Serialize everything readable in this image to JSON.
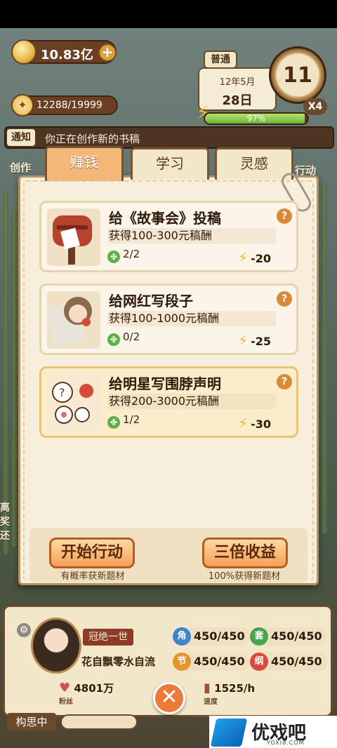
{
  "resources": {
    "coins": "10.83亿",
    "inspiration": "12288/19999",
    "plus_label": "+"
  },
  "calendar": {
    "mode": "普通",
    "month": "12年5月",
    "day": "28日",
    "hour": "11",
    "energy_percent_label": "97%",
    "energy_fraction": 0.97,
    "multiplier": "X4"
  },
  "notice": {
    "tag": "通知",
    "text": "你正在创作新的书稿"
  },
  "side": {
    "left_label": "创作",
    "right_label": "行动",
    "left_low": "离\n奖\n还"
  },
  "tabs": [
    {
      "label": "赚钱",
      "active": true
    },
    {
      "label": "学习",
      "active": false
    },
    {
      "label": "灵感",
      "active": false
    }
  ],
  "tasks": [
    {
      "title": "给《故事会》投稿",
      "reward": "获得100-300元稿酬",
      "count": "2/2",
      "cost": "-20",
      "highlight": false,
      "help": "?"
    },
    {
      "title": "给网红写段子",
      "reward": "获得100-1000元稿酬",
      "count": "0/2",
      "cost": "-25",
      "highlight": false,
      "help": "?"
    },
    {
      "title": "给明星写围脖声明",
      "reward": "获得200-3000元稿酬",
      "count": "1/2",
      "cost": "-30",
      "highlight": true,
      "help": "?"
    }
  ],
  "actions": {
    "start_label": "开始行动",
    "start_sub": "有概率获新题材",
    "triple_label": "三倍收益",
    "triple_sub": "100%获得新题材"
  },
  "player": {
    "title": "冠绝一世",
    "name": "花自飘零水自流",
    "stats": [
      {
        "icon_char": "角",
        "value": "450/450",
        "color": "#3f86c9"
      },
      {
        "icon_char": "套",
        "value": "450/450",
        "color": "#4aa54a"
      },
      {
        "icon_char": "节",
        "value": "450/450",
        "color": "#e0952e"
      },
      {
        "icon_char": "纲",
        "value": "450/450",
        "color": "#d94c3c"
      }
    ],
    "fans_label": "粉丝",
    "fans": "4801万",
    "speed_label": "速度",
    "speed": "1525/h",
    "thinking": "构思中",
    "close_icon": "close-icon"
  },
  "watermark": {
    "text": "优戏吧",
    "sub": "YOXI8.COM"
  }
}
